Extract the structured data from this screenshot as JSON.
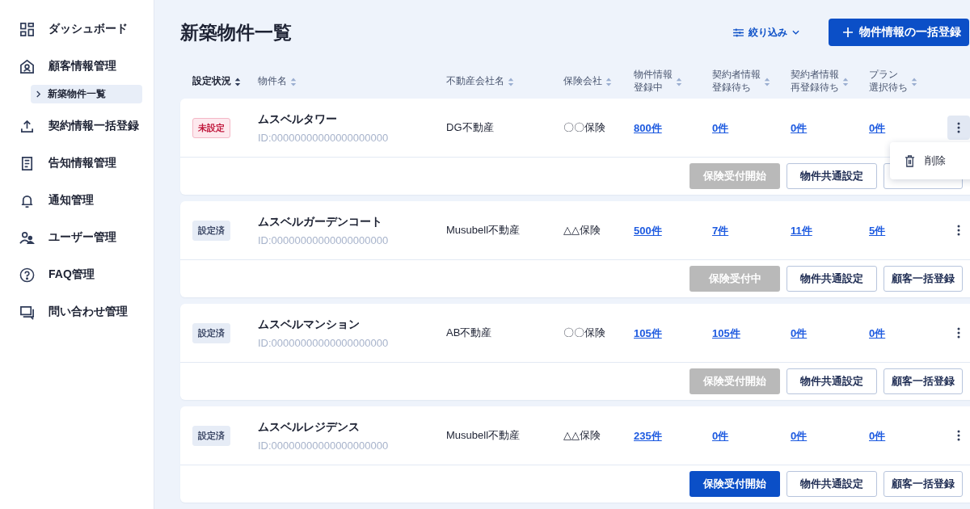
{
  "sidebar": {
    "items": [
      {
        "label": "ダッシュボード"
      },
      {
        "label": "顧客情報管理",
        "children": [
          {
            "label": "新築物件一覧",
            "selected": true
          }
        ]
      },
      {
        "label": "契約情報一括登録"
      },
      {
        "label": "告知情報管理"
      },
      {
        "label": "通知管理"
      },
      {
        "label": "ユーザー管理"
      },
      {
        "label": "FAQ管理"
      },
      {
        "label": "問い合わせ管理"
      }
    ]
  },
  "page": {
    "title": "新築物件一覧",
    "filter_label": "絞り込み",
    "bulk_button": "物件情報の一括登録"
  },
  "table": {
    "columns": [
      {
        "lines": [
          "設定状況"
        ],
        "sorted": true
      },
      {
        "lines": [
          "物件名"
        ],
        "sorted": false
      },
      {
        "lines": [
          "不動産会社名"
        ],
        "sorted": false
      },
      {
        "lines": [
          "保険会社"
        ],
        "sorted": false
      },
      {
        "lines": [
          "物件情報",
          "登録中"
        ],
        "sorted": false
      },
      {
        "lines": [
          "契約者情報",
          "登録待ち"
        ],
        "sorted": false
      },
      {
        "lines": [
          "契約者情報",
          "再登録待ち"
        ],
        "sorted": false
      },
      {
        "lines": [
          "プラン",
          "選択待ち"
        ],
        "sorted": false
      }
    ],
    "rows": [
      {
        "status": {
          "label": "未設定",
          "kind": "unset"
        },
        "name": "ムスベルタワー",
        "id": "ID:00000000000000000000",
        "company": "DG不動産",
        "insurer": "〇〇保険",
        "counts": [
          "800件",
          "0件",
          "0件",
          "0件"
        ],
        "menu_open": true,
        "menu_items": [
          "削除"
        ],
        "start_button": {
          "label": "保険受付開始",
          "disabled": true
        },
        "common_button": "物件共通設定",
        "bulk_button": null
      },
      {
        "status": {
          "label": "設定済",
          "kind": "set"
        },
        "name": "ムスベルガーデンコート",
        "id": "ID:00000000000000000000",
        "company": "Musubell不動産",
        "insurer": "△△保険",
        "counts": [
          "500件",
          "7件",
          "11件",
          "5件"
        ],
        "menu_open": false,
        "menu_items": [],
        "start_button": {
          "label": "保険受付中",
          "disabled": true
        },
        "common_button": "物件共通設定",
        "bulk_button": "顧客一括登録"
      },
      {
        "status": {
          "label": "設定済",
          "kind": "set"
        },
        "name": "ムスベルマンション",
        "id": "ID:00000000000000000000",
        "company": "AB不動産",
        "insurer": "〇〇保険",
        "counts": [
          "105件",
          "105件",
          "0件",
          "0件"
        ],
        "menu_open": false,
        "menu_items": [],
        "start_button": {
          "label": "保険受付開始",
          "disabled": true
        },
        "common_button": "物件共通設定",
        "bulk_button": "顧客一括登録"
      },
      {
        "status": {
          "label": "設定済",
          "kind": "set"
        },
        "name": "ムスベルレジデンス",
        "id": "ID:00000000000000000000",
        "company": "Musubell不動産",
        "insurer": "△△保険",
        "counts": [
          "235件",
          "0件",
          "0件",
          "0件"
        ],
        "menu_open": false,
        "menu_items": [],
        "start_button": {
          "label": "保険受付開始",
          "disabled": false
        },
        "common_button": "物件共通設定",
        "bulk_button": "顧客一括登録"
      }
    ]
  }
}
